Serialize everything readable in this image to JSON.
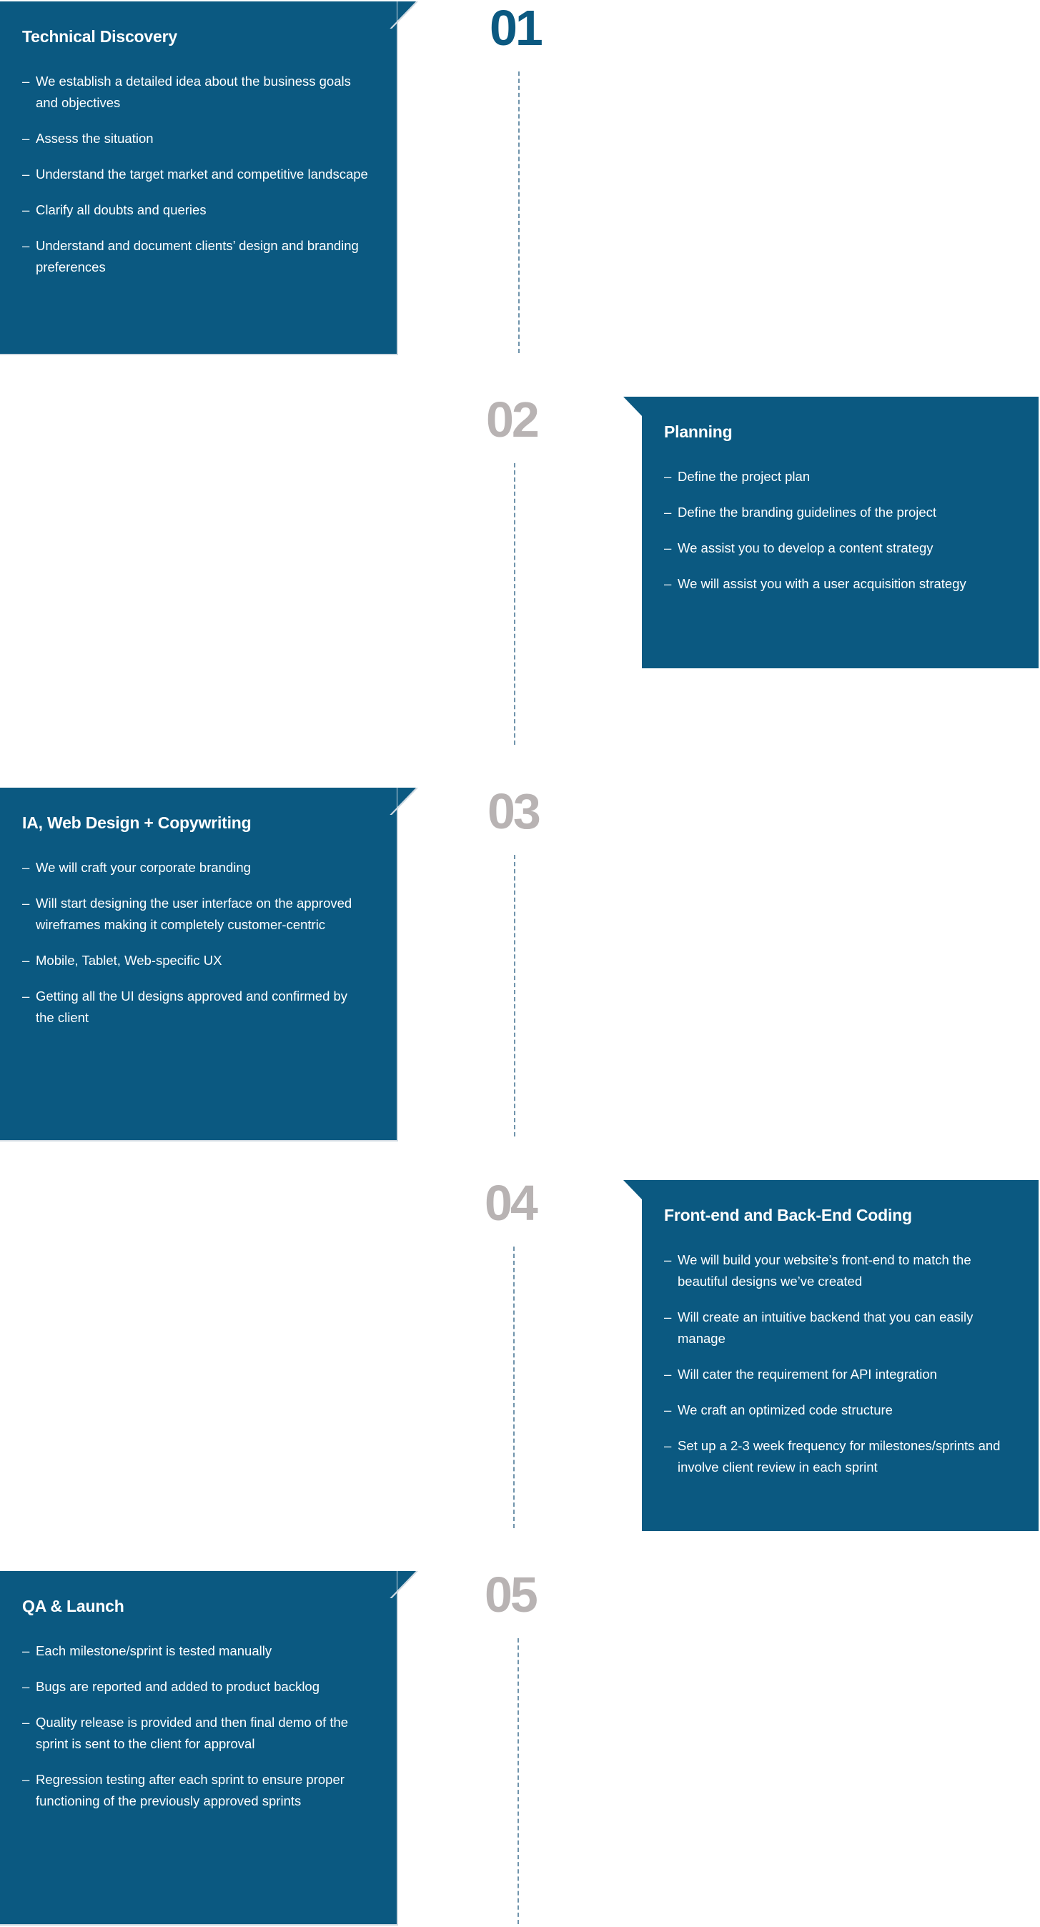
{
  "colors": {
    "card_bg": "#0b5981",
    "active_number": "#0b5981",
    "inactive_number": "#b8b3b3",
    "dashed_line": "#6f93ab",
    "card_text": "#ffffff"
  },
  "bullet_glyph": "–",
  "steps": [
    {
      "number": "01",
      "title": "Technical Discovery",
      "items": [
        "We establish a detailed idea about the business goals and objectives",
        "Assess the situation",
        "Understand the target market and competitive landscape",
        "Clarify all doubts and queries",
        "Understand and document clients’ design and branding preferences"
      ]
    },
    {
      "number": "02",
      "title": "Planning",
      "items": [
        "Define the project plan",
        "Define the branding guidelines of the project",
        "We assist you to develop a content strategy",
        "We will assist you with a user acquisition strategy"
      ]
    },
    {
      "number": "03",
      "title": "IA, Web Design + Copywriting",
      "items": [
        "We will craft your corporate branding",
        "Will start designing the user interface on the approved wireframes making it completely customer-centric",
        "Mobile, Tablet, Web-specific UX",
        "Getting all the UI designs approved and confirmed by the client"
      ]
    },
    {
      "number": "04",
      "title": "Front-end and Back-End Coding",
      "items": [
        "We will build your website’s front-end to match the beautiful designs we’ve created",
        "Will create an intuitive backend that you can easily manage",
        "Will cater the requirement for API integration",
        "We craft an optimized code structure",
        "Set up a 2-3 week frequency for milestones/sprints and involve client review in each sprint"
      ]
    },
    {
      "number": "05",
      "title": "QA & Launch",
      "items": [
        "Each milestone/sprint is tested manually",
        "Bugs are reported and added to product backlog",
        "Quality release is provided and then final demo of the sprint is sent to the client for approval",
        "Regression testing after each sprint to ensure proper functioning of the previously approved sprints"
      ]
    }
  ]
}
